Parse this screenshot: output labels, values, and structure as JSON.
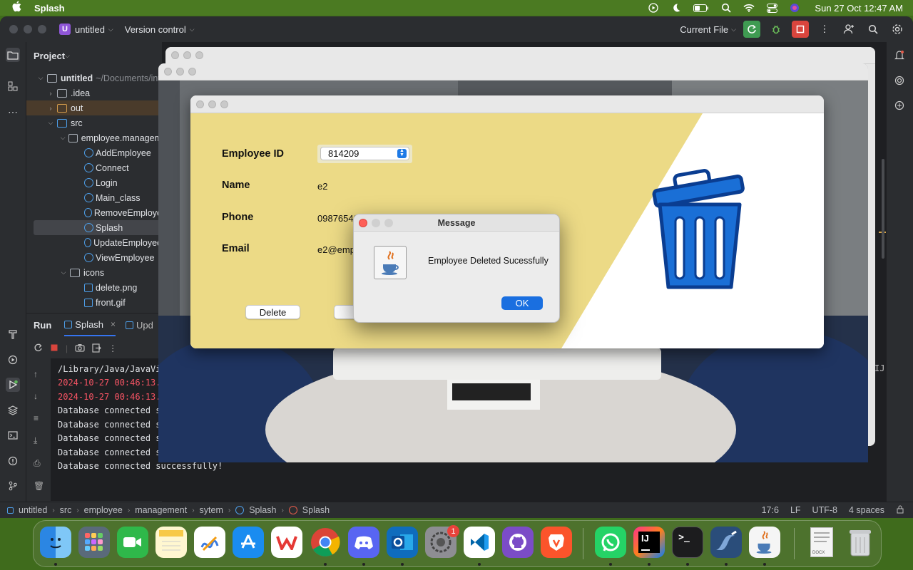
{
  "menubar": {
    "app_name": "Splash",
    "datetime": "Sun 27 Oct  12:47 AM"
  },
  "ide": {
    "project_name": "untitled",
    "project_badge": "U",
    "version_control": "Version control",
    "run_config": "Current File",
    "project_panel_title": "Project",
    "tree": [
      {
        "label": "untitled",
        "suffix": "~/Documents/int"
      },
      {
        "label": ".idea"
      },
      {
        "label": "out"
      },
      {
        "label": "src"
      },
      {
        "label": "employee.managem"
      },
      {
        "label": "AddEmployee"
      },
      {
        "label": "Connect"
      },
      {
        "label": "Login"
      },
      {
        "label": "Main_class"
      },
      {
        "label": "RemoveEmploye"
      },
      {
        "label": "Splash"
      },
      {
        "label": "UpdateEmployee"
      },
      {
        "label": "ViewEmployee"
      },
      {
        "label": "icons"
      },
      {
        "label": "delete.png"
      },
      {
        "label": "front.gif"
      }
    ],
    "run": {
      "title": "Run",
      "tab1": "Splash",
      "tab2": "Upd"
    },
    "console": [
      {
        "text": "/Library/Java/JavaVi",
        "color": "#dfe1e5"
      },
      {
        "text": "2024-10-27 00:46:13.3",
        "color": "#f75464"
      },
      {
        "text": "2024-10-27 00:46:13.3",
        "color": "#f75464"
      },
      {
        "text": "Database connected su",
        "color": "#dfe1e5"
      },
      {
        "text": "Database connected su",
        "color": "#dfe1e5"
      },
      {
        "text": "Database connected su",
        "color": "#dfe1e5"
      },
      {
        "text": "Database connected su",
        "color": "#dfe1e5"
      },
      {
        "text": "Database connected successfully!",
        "color": "#dfe1e5"
      }
    ],
    "status": {
      "crumbs": [
        "untitled",
        "src",
        "employee",
        "management",
        "sytem",
        "Splash",
        "Splash"
      ],
      "position": "17:6",
      "line_sep": "LF",
      "encoding": "UTF-8",
      "indent": "4 spaces"
    },
    "right_edge_text": "IJ"
  },
  "delete_window": {
    "fields": {
      "employee_id_label": "Employee ID",
      "employee_id_value": "814209",
      "name_label": "Name",
      "name_value": "e2",
      "phone_label": "Phone",
      "phone_value": "09876543",
      "email_label": "Email",
      "email_value": "e2@emp."
    },
    "delete_button": "Delete",
    "icon": "trash-can-icon"
  },
  "message_dialog": {
    "title": "Message",
    "text": "Employee Deleted Sucessfully",
    "ok_button": "OK",
    "icon": "java-cup-icon"
  },
  "dock": {
    "notification_badge": "1",
    "apps": [
      "finder-icon",
      "launchpad-icon",
      "facetime-icon",
      "notes-icon",
      "freeform-icon",
      "appstore-icon",
      "wps-icon",
      "chrome-icon",
      "discord-icon",
      "outlook-icon",
      "system-settings-icon",
      "vscode-icon",
      "github-icon",
      "brave-icon",
      "whatsapp-icon",
      "intellij-icon",
      "terminal-icon",
      "mysql-workbench-icon",
      "java-icon",
      "document-icon",
      "trash-icon"
    ],
    "doc_label": "DOCX"
  },
  "colors": {
    "menubar_bg": "#4b7a22",
    "ide_bg": "#1e1f22",
    "panel_bg": "#2b2d30",
    "accent_blue": "#1a6fd6",
    "error_red": "#f75464",
    "run_green": "#3f9b52",
    "stop_red": "#d9453d"
  }
}
